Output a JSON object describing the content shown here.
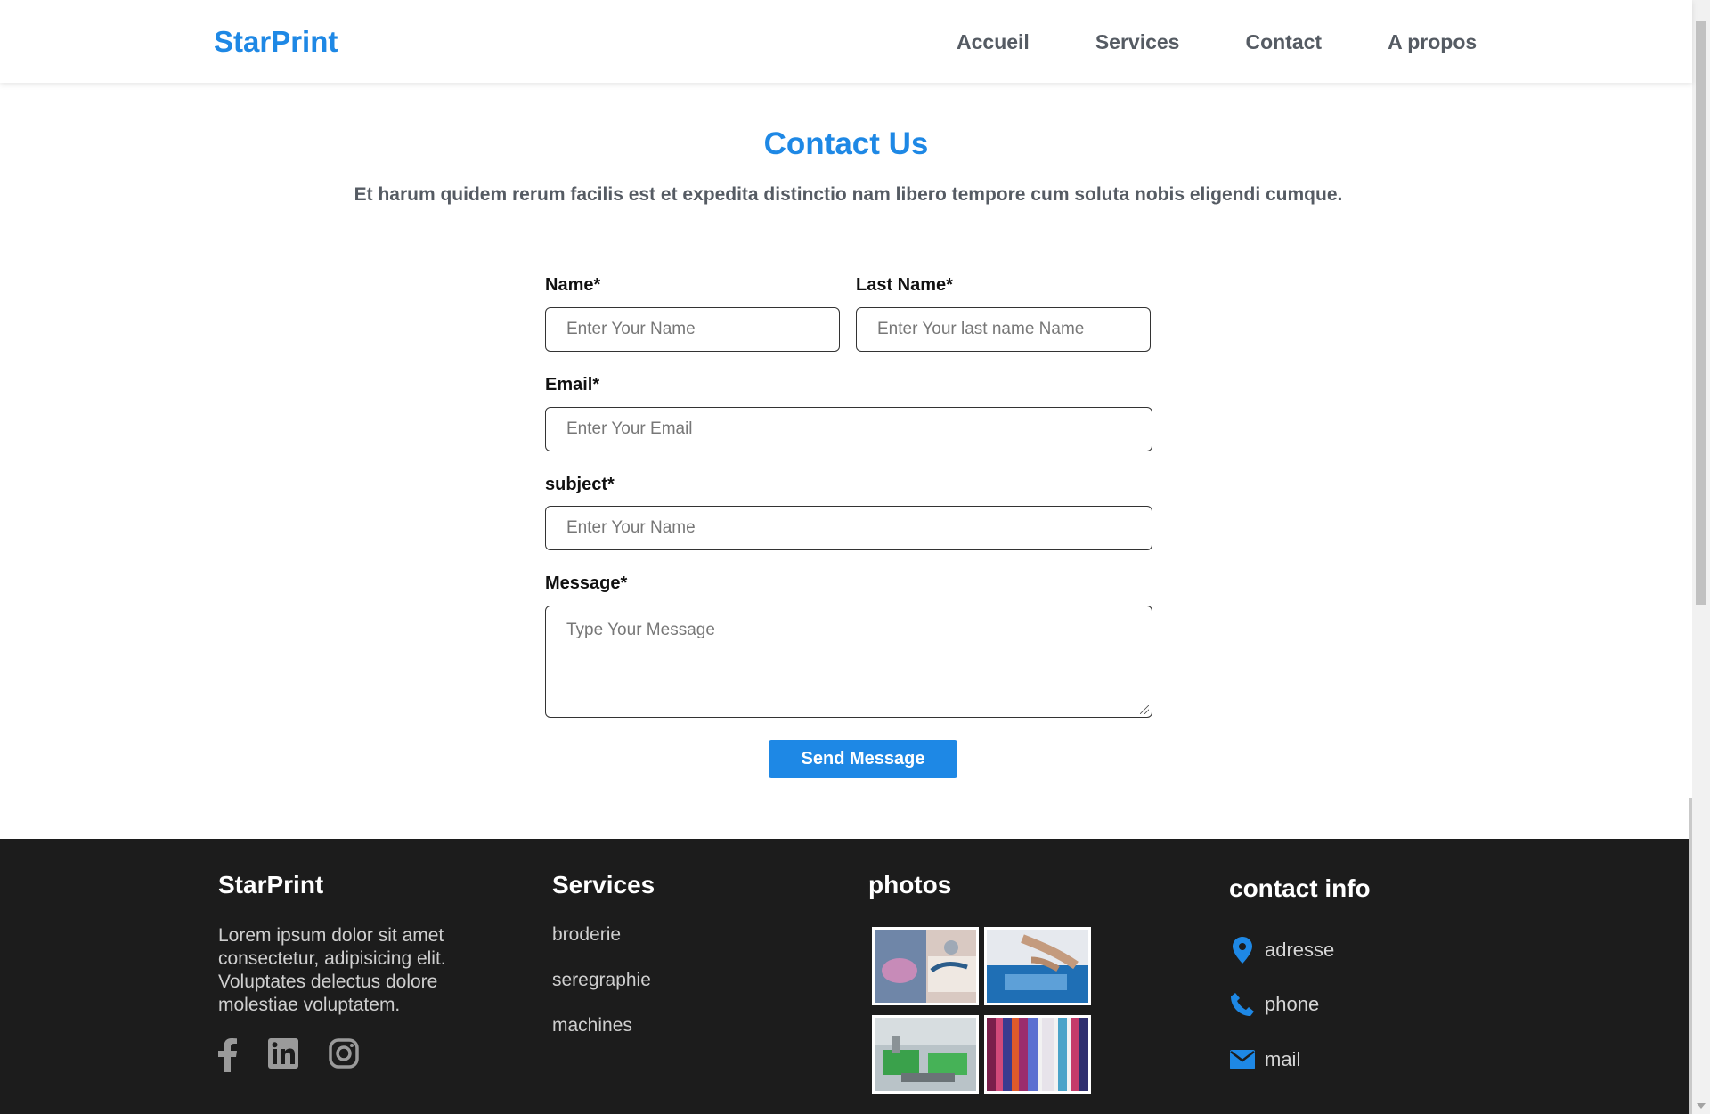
{
  "header": {
    "brand": "StarPrint",
    "nav": [
      "Accueil",
      "Services",
      "Contact",
      "A propos"
    ]
  },
  "contact": {
    "title": "Contact Us",
    "subtitle": "Et harum quidem rerum facilis est et expedita distinctio nam libero tempore cum soluta nobis eligendi cumque.",
    "fields": {
      "name_label": "Name*",
      "name_placeholder": "Enter Your Name",
      "lastname_label": "Last Name*",
      "lastname_placeholder": "Enter Your last name Name",
      "email_label": "Email*",
      "email_placeholder": "Enter Your Email",
      "subject_label": "subject*",
      "subject_placeholder": "Enter Your Name",
      "message_label": "Message*",
      "message_placeholder": "Type Your Message"
    },
    "send_label": "Send Message"
  },
  "footer": {
    "about": {
      "title": "StarPrint",
      "text": "Lorem ipsum dolor sit amet consectetur, adipisicing elit. Voluptates delectus dolore molestiae voluptatem.",
      "social_icons": [
        "facebook-icon",
        "linkedin-icon",
        "instagram-icon"
      ]
    },
    "services": {
      "title": "Services",
      "items": [
        "broderie",
        "seregraphie",
        "machines"
      ]
    },
    "photos": {
      "title": "photos"
    },
    "contact_info": {
      "title": "contact info",
      "items": [
        {
          "icon": "location-pin-icon",
          "label": "adresse"
        },
        {
          "icon": "phone-icon",
          "label": "phone"
        },
        {
          "icon": "mail-icon",
          "label": "mail"
        }
      ]
    }
  },
  "colors": {
    "accent": "#1e88e5",
    "footer_bg": "#1c1c1c",
    "nav_text": "#555b63"
  }
}
